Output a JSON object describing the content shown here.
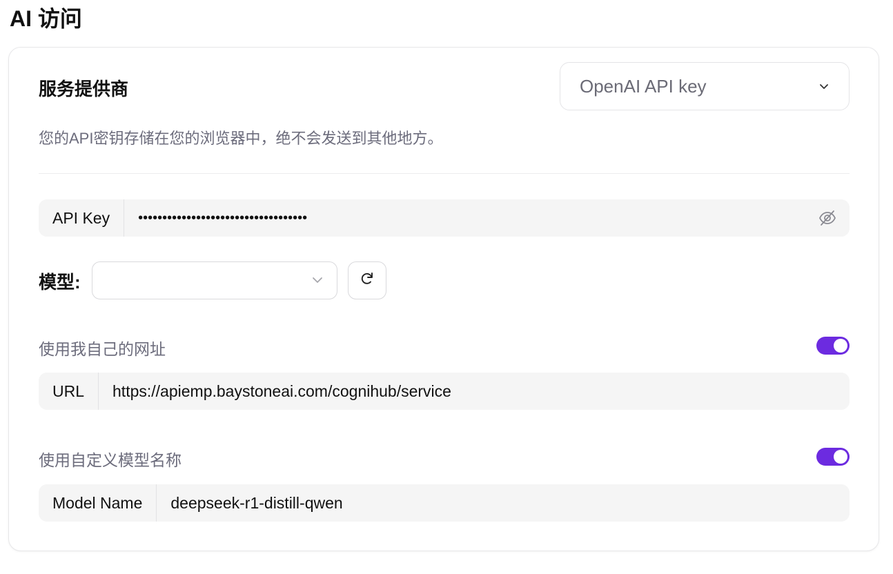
{
  "page": {
    "title": "AI 访问"
  },
  "provider": {
    "label": "服务提供商",
    "selected": "OpenAI API key",
    "note": "您的API密钥存储在您的浏览器中，绝不会发送到其他地方。"
  },
  "api_key": {
    "label": "API Key",
    "value": "•••••••••••••••••••••••••••••••••••",
    "visibility_icon": "eye-off-icon"
  },
  "model": {
    "label": "模型:",
    "selected": "",
    "refresh_icon": "refresh-icon"
  },
  "custom_url": {
    "toggle_label": "使用我自己的网址",
    "enabled": true,
    "field_label": "URL",
    "value": "https://apiemp.baystoneai.com/cognihub/service"
  },
  "custom_model": {
    "toggle_label": "使用自定义模型名称",
    "enabled": true,
    "field_label": "Model Name",
    "value": "deepseek-r1-distill-qwen"
  },
  "colors": {
    "accent": "#6c2be0",
    "muted_text": "#6c6c7c",
    "field_bg": "#f5f5f5"
  }
}
